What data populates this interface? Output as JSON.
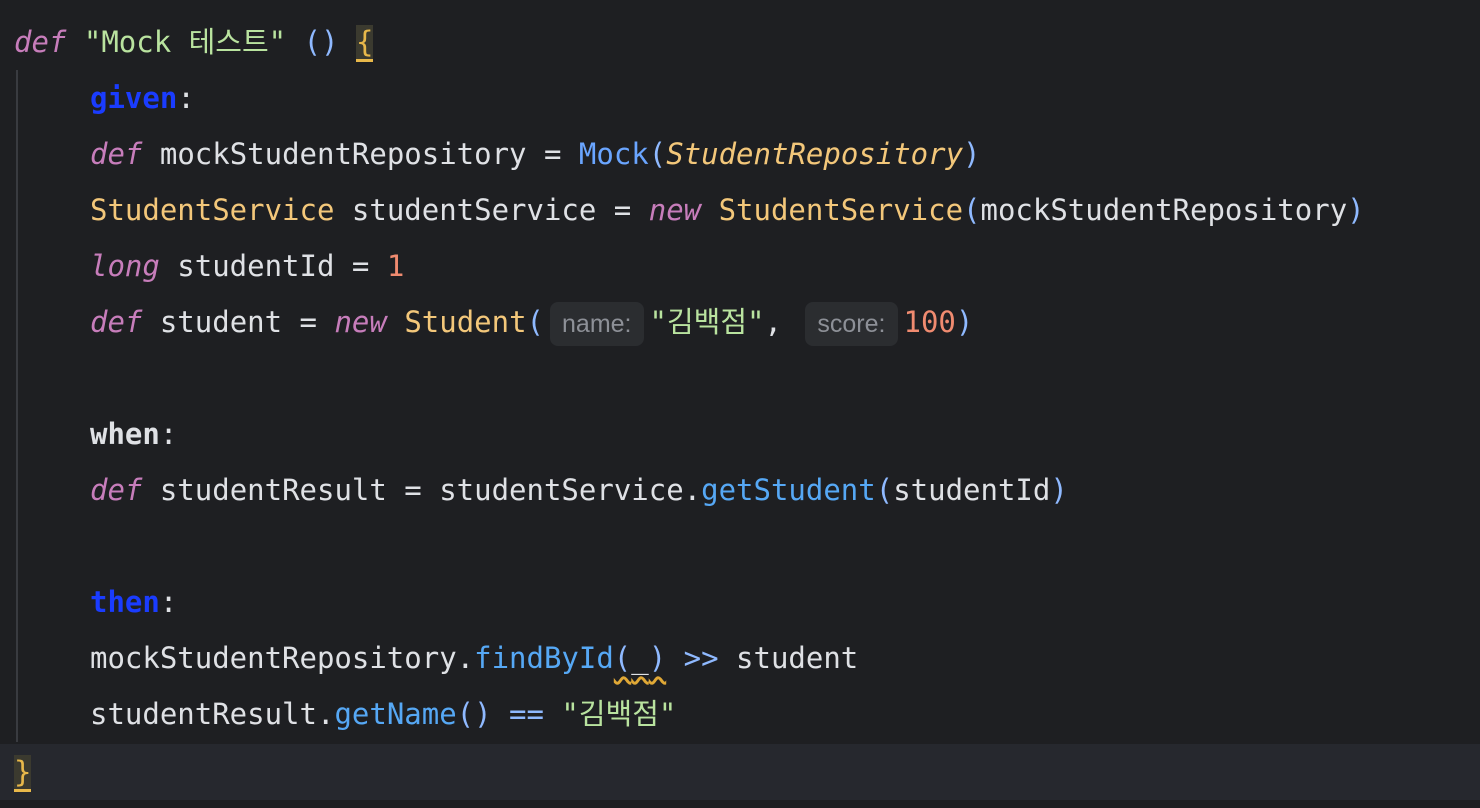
{
  "method": {
    "def_kw": "def",
    "name": "\"Mock 테스트\"",
    "parens": "()",
    "open_brace": "{",
    "close_brace": "}"
  },
  "given": {
    "label": "given",
    "line1": {
      "def": "def",
      "var": "mockStudentRepository",
      "eq": " = ",
      "fn": "Mock",
      "open": "(",
      "arg": "StudentRepository",
      "close": ")"
    },
    "line2": {
      "type": "StudentService",
      "var": " studentService",
      "eq": " = ",
      "new": "new",
      "cls": "StudentService",
      "open": "(",
      "arg": "mockStudentRepository",
      "close": ")"
    },
    "line3": {
      "type": "long",
      "var": " studentId",
      "eq": " = ",
      "num": "1"
    },
    "line4": {
      "def": "def",
      "var": " student",
      "eq": " = ",
      "new": "new",
      "cls": "Student",
      "open": "(",
      "hint1": "name:",
      "str": "\"김백점\"",
      "comma": ",",
      "hint2": "score:",
      "num": "100",
      "close": ")"
    }
  },
  "when": {
    "label": "when",
    "line1": {
      "def": "def",
      "var": " studentResult",
      "eq": " = ",
      "obj": "studentService.",
      "fn": "getStudent",
      "open": "(",
      "arg": "studentId",
      "close": ")"
    }
  },
  "then": {
    "label": "then",
    "line1": {
      "obj": "mockStudentRepository.",
      "fn": "findById",
      "open": "(",
      "arg": "_",
      "close": ")",
      "op": " >> ",
      "ret": "student"
    },
    "line2": {
      "obj": "studentResult.",
      "fn": "getName",
      "parens": "()",
      "op": " == ",
      "str": "\"김백점\""
    }
  },
  "colon": ":"
}
